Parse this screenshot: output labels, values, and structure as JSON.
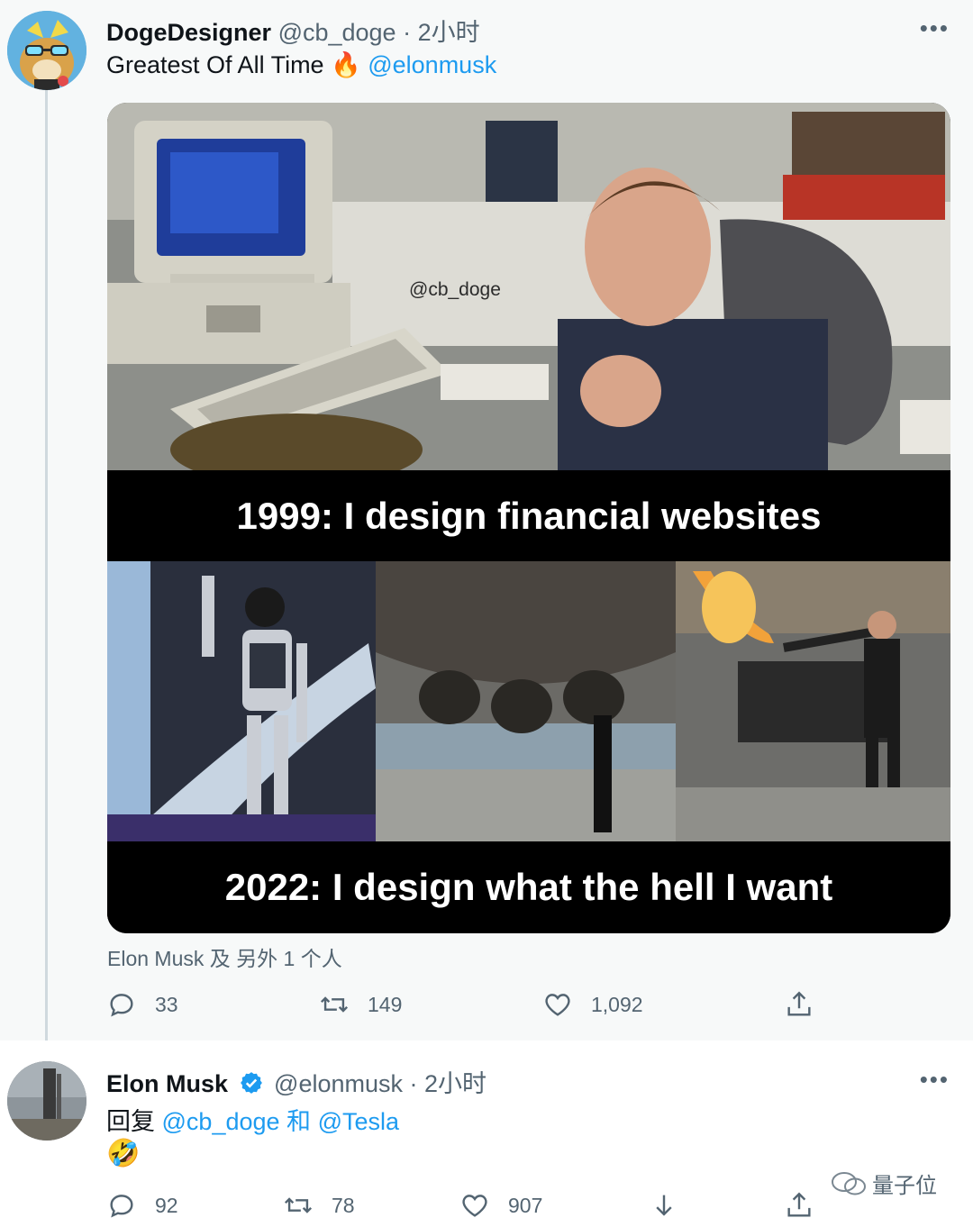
{
  "tweet1": {
    "display_name": "DogeDesigner",
    "handle": "@cb_doge",
    "time": "· 2小时",
    "text": "Greatest Of All Time",
    "emoji": "🔥",
    "mention": "@elonmusk",
    "image_watermark": "@cb_doge",
    "caption_top": "1999: I design financial websites",
    "caption_bottom": "2022: I design what the hell I want",
    "liked_by": "Elon Musk 及 另外 1 个人",
    "replies": "33",
    "retweets": "149",
    "likes": "1,092",
    "more": "•••"
  },
  "tweet2": {
    "display_name": "Elon Musk",
    "handle": "@elonmusk",
    "time": "· 2小时",
    "reply_prefix": "回复",
    "reply_to_1": "@cb_doge",
    "reply_and": "和",
    "reply_to_2": "@Tesla",
    "emoji": "🤣",
    "replies": "92",
    "retweets": "78",
    "likes": "907",
    "more": "•••"
  },
  "watermark": {
    "text": "量子位"
  },
  "colors": {
    "accent": "#1d9bf0",
    "muted": "#536471",
    "text": "#0f1419"
  }
}
